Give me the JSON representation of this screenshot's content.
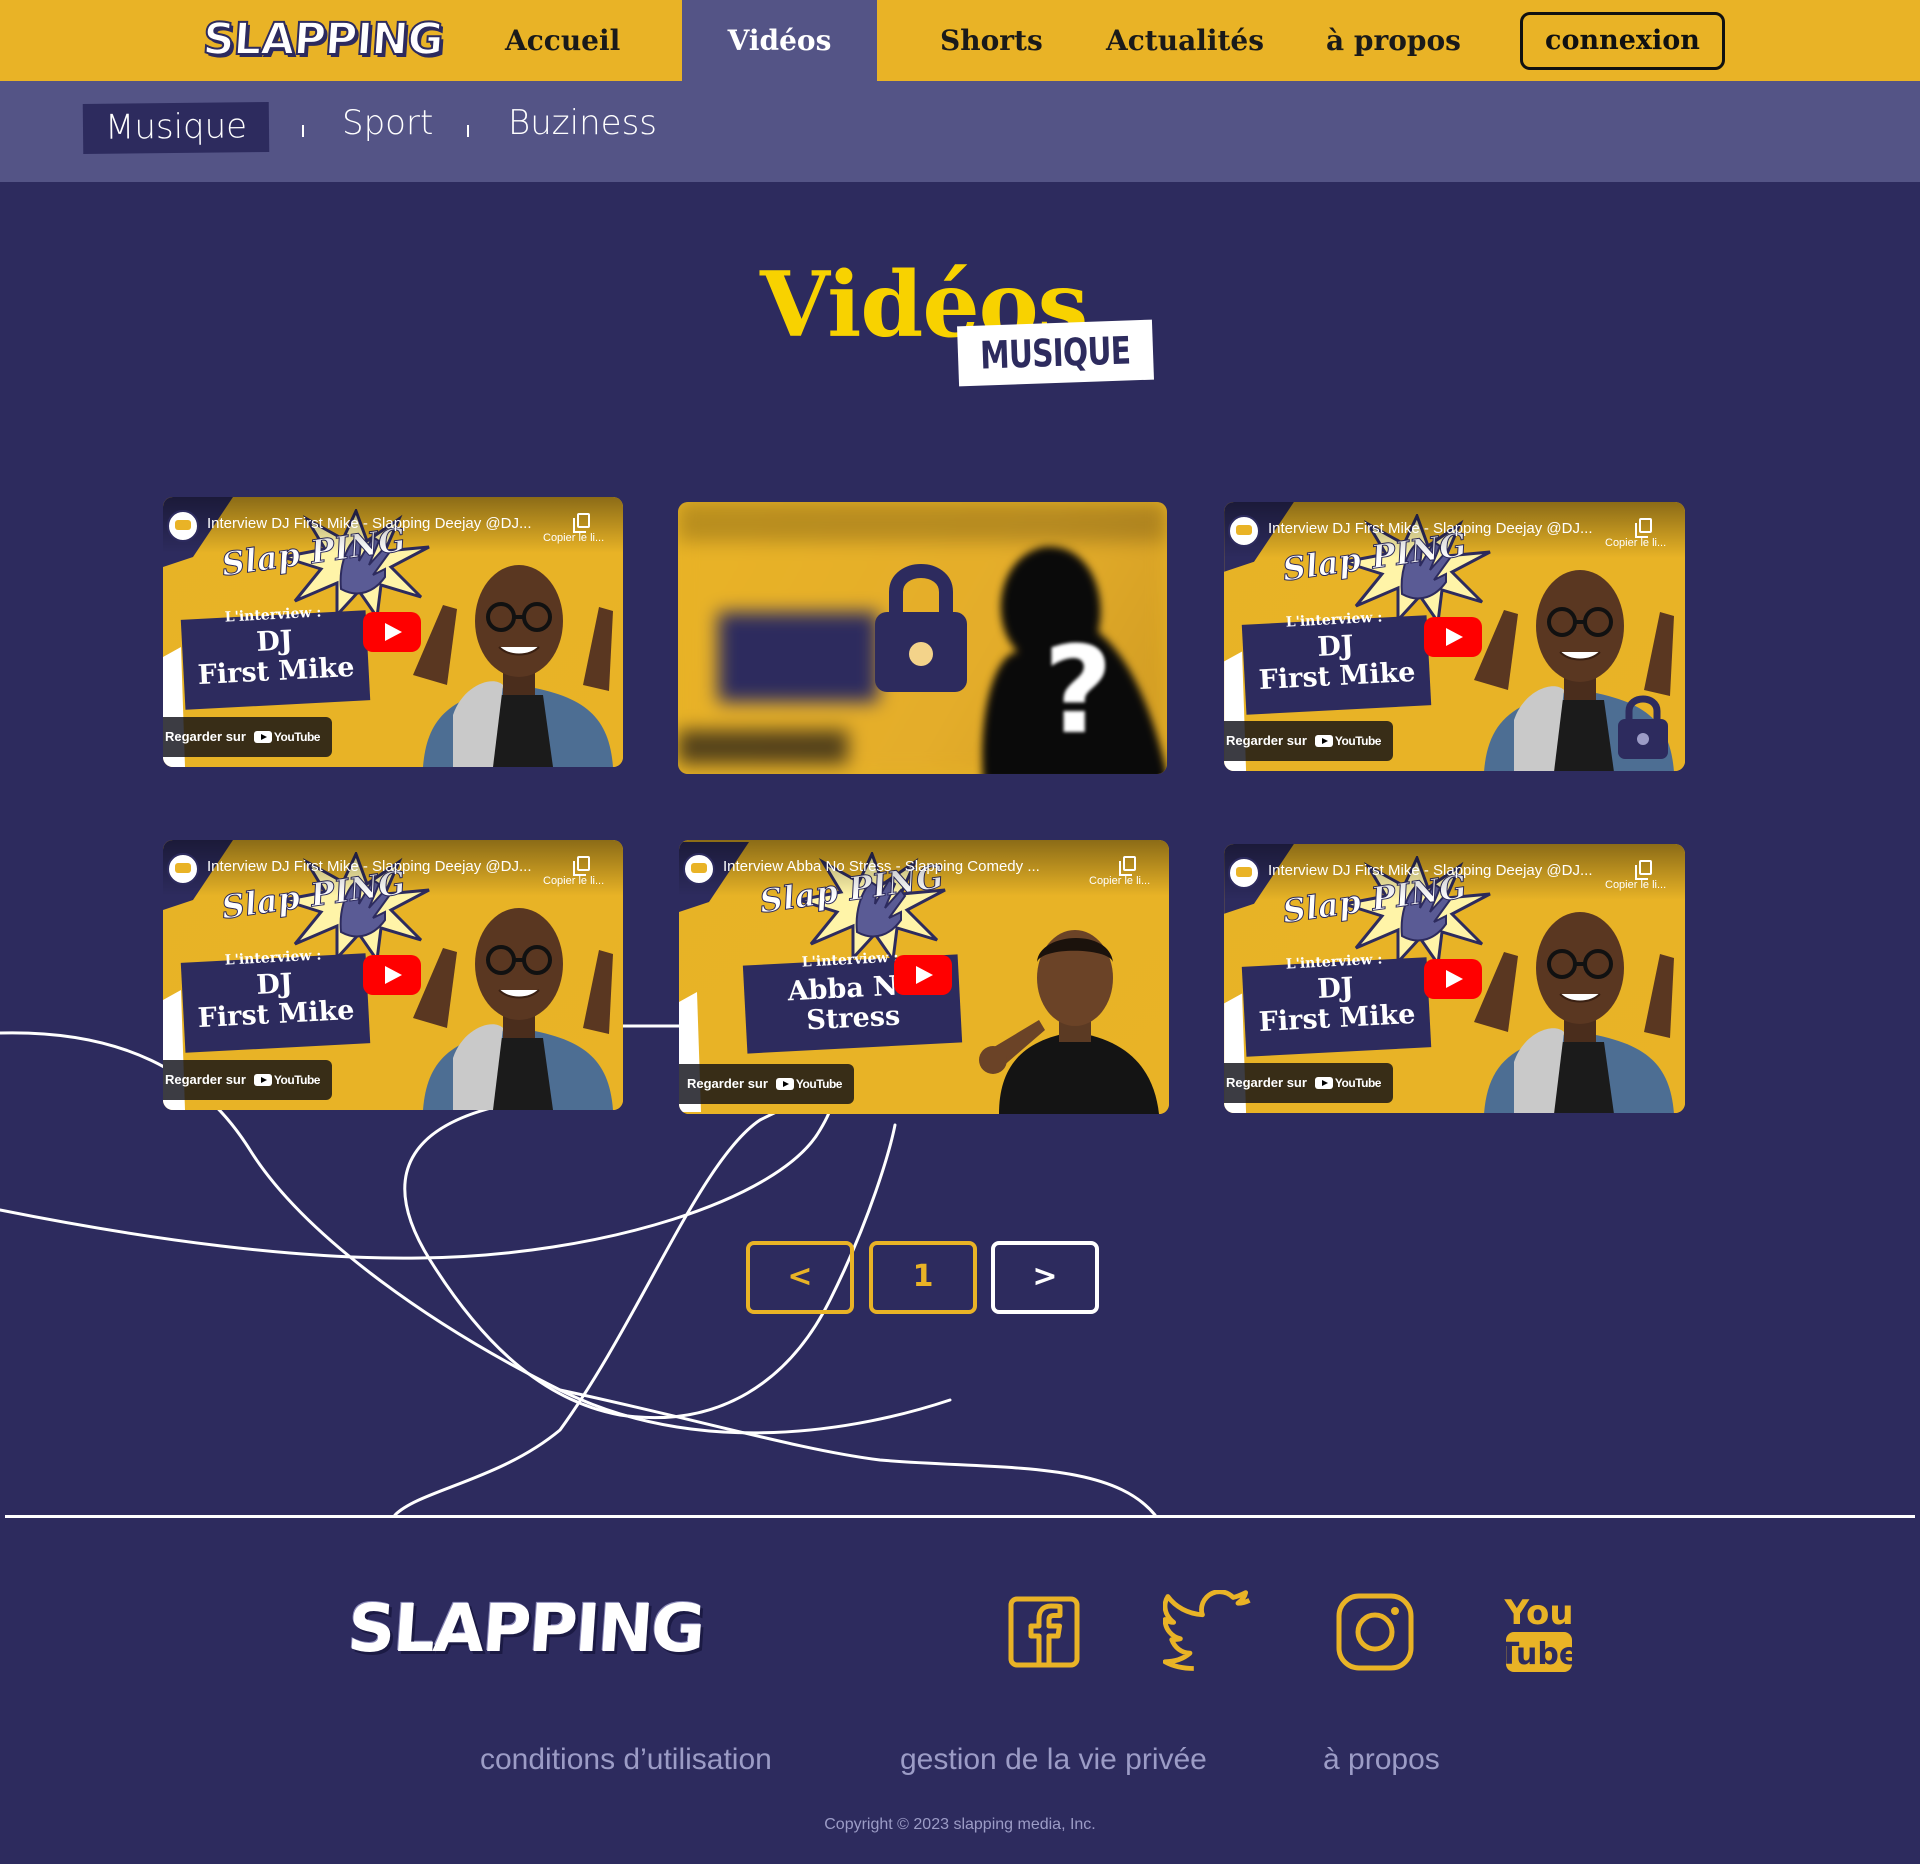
{
  "brand": {
    "name": "SLAPPING"
  },
  "nav": {
    "items": [
      {
        "label": "Accueil",
        "active": false
      },
      {
        "label": "Vidéos",
        "active": true
      },
      {
        "label": "Shorts",
        "active": false
      },
      {
        "label": "Actualités",
        "active": false
      },
      {
        "label": "à propos",
        "active": false
      }
    ],
    "login_label": "connexion"
  },
  "subnav": {
    "items": [
      {
        "label": "Musique",
        "active": true
      },
      {
        "label": "Sport",
        "active": false
      },
      {
        "label": "Buziness",
        "active": false
      }
    ]
  },
  "page": {
    "title": "Vidéos",
    "category_tag": "MUSIQUE"
  },
  "videos": [
    {
      "title": "Interview DJ First Mike - Slapping Deejay @DJ...",
      "copy_label": "Copier le li...",
      "thumb_brand": "Slap PING",
      "interview_label": "L'interview :",
      "name_line1": "DJ",
      "name_line2": "First Mike",
      "watch_label": "Regarder sur",
      "yt_label": "YouTube",
      "locked": false,
      "lock_badge": false
    },
    {
      "title": "",
      "locked": true,
      "lock_icon": "lock-icon",
      "mystery_icon": "question-mark-icon"
    },
    {
      "title": "Interview DJ First Mike - Slapping Deejay @DJ...",
      "copy_label": "Copier le li...",
      "thumb_brand": "Slap PING",
      "interview_label": "L'interview :",
      "name_line1": "DJ",
      "name_line2": "First Mike",
      "watch_label": "Regarder sur",
      "yt_label": "YouTube",
      "locked": false,
      "lock_badge": true
    },
    {
      "title": "Interview DJ First Mike - Slapping Deejay @DJ...",
      "copy_label": "Copier le li...",
      "thumb_brand": "Slap PING",
      "interview_label": "L'interview :",
      "name_line1": "DJ",
      "name_line2": "First Mike",
      "watch_label": "Regarder sur",
      "yt_label": "YouTube",
      "locked": false,
      "lock_badge": false
    },
    {
      "title": "Interview Abba No Stress - Slapping Comedy ...",
      "copy_label": "Copier le li...",
      "thumb_brand": "Slap PING",
      "interview_label": "L'interview :",
      "name_line1": "Abba No",
      "name_line2": "Stress",
      "watch_label": "Regarder sur",
      "yt_label": "YouTube",
      "locked": false,
      "lock_badge": false
    },
    {
      "title": "Interview DJ First Mike - Slapping Deejay @DJ...",
      "copy_label": "Copier le li...",
      "thumb_brand": "Slap PING",
      "interview_label": "L'interview :",
      "name_line1": "DJ",
      "name_line2": "First Mike",
      "watch_label": "Regarder sur",
      "yt_label": "YouTube",
      "locked": false,
      "lock_badge": false
    }
  ],
  "pagination": {
    "prev_label": "<",
    "current_page": "1",
    "next_label": ">"
  },
  "footer": {
    "social": [
      "facebook-icon",
      "twitter-icon",
      "instagram-icon",
      "youtube-icon"
    ],
    "youtube_text_top": "You",
    "youtube_text_bottom": "Tube",
    "links": [
      "conditions d’utilisation",
      "gestion de la vie privée",
      "à propos"
    ],
    "copyright": "Copyright © 2023 slapping media, Inc."
  },
  "colors": {
    "accent": "#e9b326",
    "background": "#2d2b5e",
    "nav_active": "#545486",
    "title_yellow": "#f8d200",
    "youtube_red": "#ff0000"
  }
}
